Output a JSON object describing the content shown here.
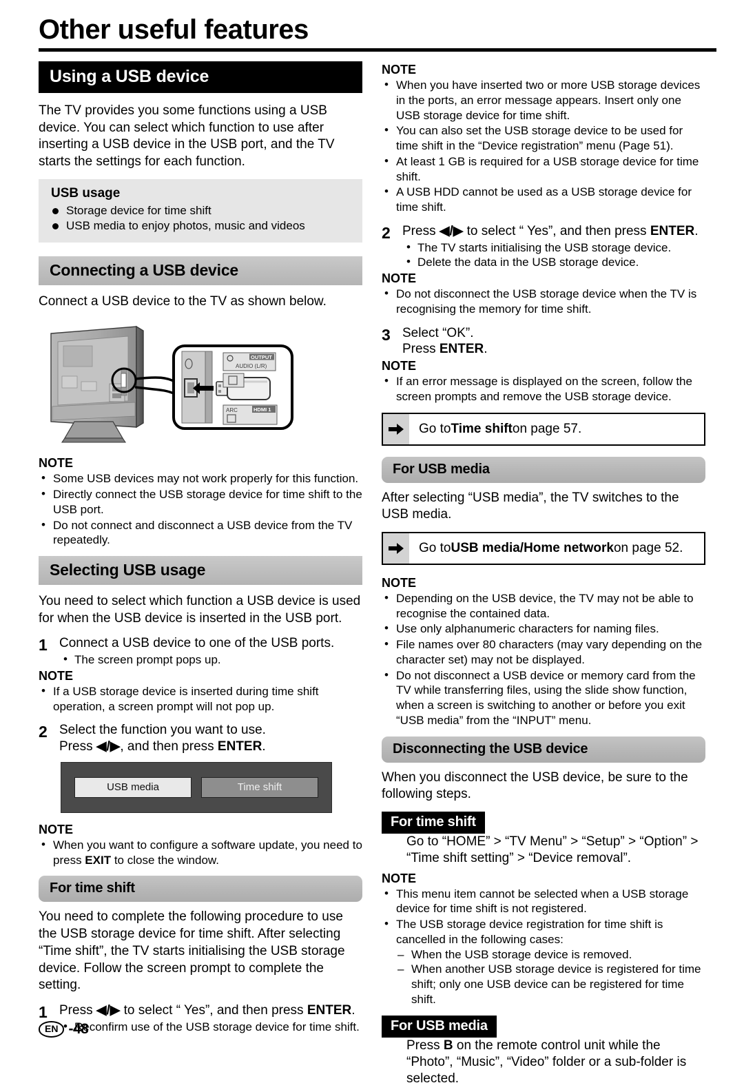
{
  "page": {
    "title": "Other useful features",
    "footer_lang": "EN",
    "footer_page": "-48"
  },
  "left": {
    "heading_using": "Using a USB device",
    "intro": "The TV provides you some functions using a USB device. You can select which function to use after inserting a USB device in the USB port, and the TV starts the settings for each function.",
    "usage_box": {
      "title": "USB usage",
      "items": [
        "Storage device for time shift",
        "USB media to enjoy photos, music and videos"
      ]
    },
    "heading_connecting": "Connecting a USB device",
    "connect_intro": "Connect a USB device to the TV as shown below.",
    "figure": {
      "label_output": "OUTPUT",
      "label_audio": "AUDIO (L/R)",
      "label_arc": "ARC",
      "label_hdmi": "HDMI 1"
    },
    "note1_title": "NOTE",
    "note1_items": [
      "Some USB devices may not work properly for this function.",
      "Directly connect the USB storage device for time shift to the USB port.",
      "Do not connect and disconnect a USB device from the TV repeatedly."
    ],
    "heading_selecting": "Selecting USB usage",
    "selecting_intro": "You need to select which function a USB device is used for when the USB device is inserted in the USB port.",
    "step1_num": "1",
    "step1_text": "Connect a USB device to one of the USB ports.",
    "step1_sub": [
      "The screen prompt pops up."
    ],
    "note2_title": "NOTE",
    "note2_items": [
      "If a USB storage device is inserted during time shift operation, a screen prompt will not pop up."
    ],
    "step2_num": "2",
    "step2_line1": "Select the function you want to use.",
    "step2_line2_pre": "Press ",
    "step2_line2_arrows": "◀/▶",
    "step2_line2_mid": ", and then press ",
    "step2_line2_bold": "ENTER",
    "step2_line2_end": ".",
    "dialog": {
      "option_selected": "USB media",
      "option_other": "Time shift"
    },
    "note3_title": "NOTE",
    "note3_pre": "When you want to configure a software update, you need to press ",
    "note3_bold": "EXIT",
    "note3_post": " to close the window.",
    "heading_for_time_shift": "For time shift",
    "time_shift_intro": "You need to complete the following procedure to use the USB storage device for time shift. After selecting “Time shift”, the TV starts initialising the USB storage device. Follow the screen prompt to complete the setting.",
    "step3_num": "1",
    "step3_pre": "Press ",
    "step3_arrows": "◀/▶",
    "step3_mid": " to select “ Yes”, and then press ",
    "step3_bold": "ENTER",
    "step3_end": ".",
    "step3_sub": [
      "Reconfirm use of the USB storage device for time shift."
    ]
  },
  "right": {
    "note1_title": "NOTE",
    "note1_items": [
      "When you have inserted two or more USB storage devices in the ports, an error message appears. Insert only one USB storage device for time shift.",
      "You can also set the USB storage device to be used for time shift in the “Device registration” menu (Page 51).",
      "At least 1 GB is required for a USB storage device for time shift.",
      "A USB HDD cannot be used as a USB storage device for time shift."
    ],
    "step2_num": "2",
    "step2_pre": "Press ",
    "step2_arrows": "◀/▶",
    "step2_mid": " to select “ Yes”, and then press ",
    "step2_bold": "ENTER",
    "step2_end": ".",
    "step2_sub": [
      "The TV starts initialising the USB storage device.",
      "Delete the data in the USB storage device."
    ],
    "note2_title": "NOTE",
    "note2_items": [
      "Do not disconnect the USB storage device when the TV is recognising the memory for time shift."
    ],
    "step3_num": "3",
    "step3_line1": "Select “OK”.",
    "step3_line2_pre": "Press ",
    "step3_line2_bold": "ENTER",
    "step3_line2_end": ".",
    "note3_title": "NOTE",
    "note3_items": [
      "If an error message is displayed on the screen, follow the screen prompts and remove the USB storage device."
    ],
    "goto1_pre": "Go to ",
    "goto1_bold": "Time shift",
    "goto1_post": " on page 57.",
    "heading_for_usb_media": "For USB media",
    "usb_media_intro": "After selecting “USB media”, the TV switches to the USB media.",
    "goto2_pre": "Go to ",
    "goto2_bold": "USB media/Home network",
    "goto2_post": " on page 52.",
    "note4_title": "NOTE",
    "note4_items": [
      "Depending on the USB device, the TV may not be able to recognise the contained data.",
      "Use only alphanumeric characters for naming files.",
      "File names over 80 characters (may vary depending on the character set) may not be displayed.",
      "Do not disconnect a USB device or memory card from the TV while transferring files, using the slide show function, when a screen is switching to another or before you exit “USB media” from the “INPUT” menu."
    ],
    "heading_disconnecting": "Disconnecting the USB device",
    "disconnect_intro": "When you disconnect the USB device, be sure to the following steps.",
    "tag_time_shift": "For time shift",
    "tag_time_shift_body": "Go to “HOME” > “TV Menu” > “Setup” > “Option” > “Time shift setting” > “Device removal”.",
    "note5_title": "NOTE",
    "note5_items": [
      "This menu item cannot be selected when a USB storage device for time shift is not registered.",
      "The USB storage device registration for time shift is cancelled in the following cases:"
    ],
    "note5_sub": [
      "When the USB storage device is removed.",
      "When another USB storage device is registered for time shift; only one USB device can be registered for time shift."
    ],
    "tag_usb_media": "For USB media",
    "tag_usb_media_pre": "Press ",
    "tag_usb_media_bold": "B",
    "tag_usb_media_post": " on the remote control unit while the “Photo”, “Music”, “Video” folder or a sub-folder is selected."
  }
}
